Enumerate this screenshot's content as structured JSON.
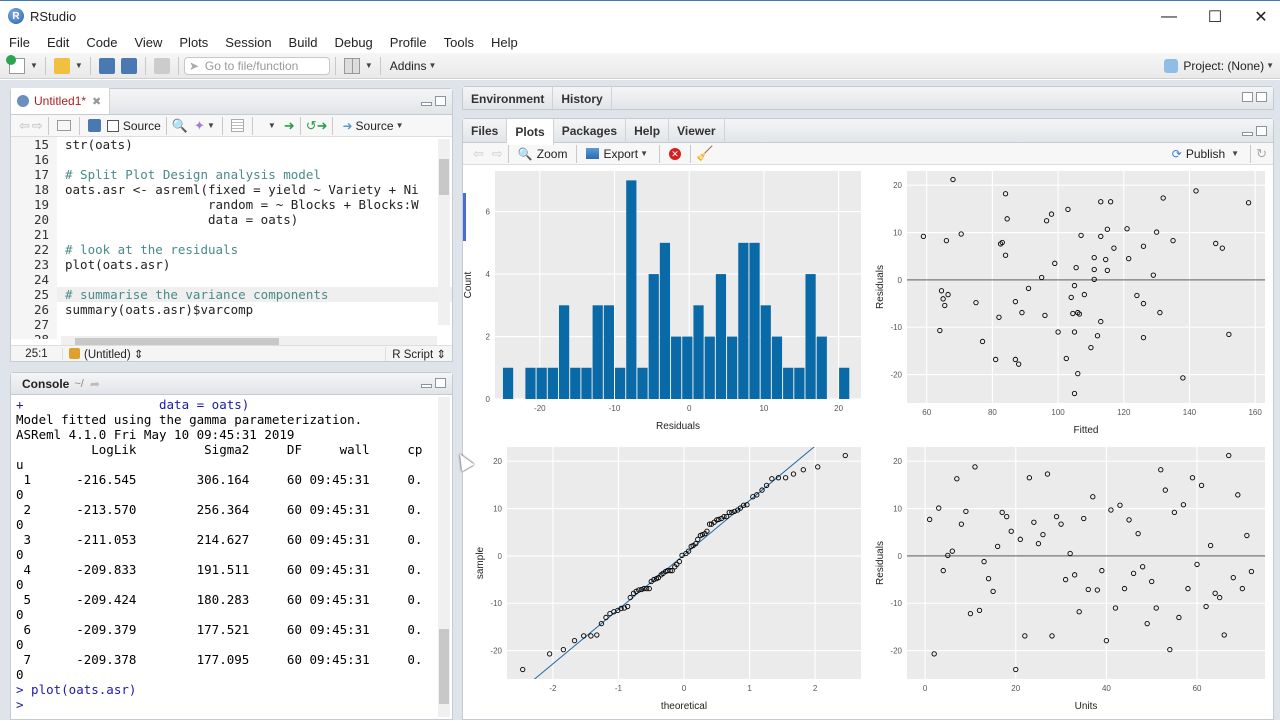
{
  "window": {
    "title": "RStudio",
    "controls": [
      "minimize",
      "maximize",
      "close"
    ]
  },
  "menu": [
    "File",
    "Edit",
    "Code",
    "View",
    "Plots",
    "Session",
    "Build",
    "Debug",
    "Profile",
    "Tools",
    "Help"
  ],
  "toolbar": {
    "goto_placeholder": "Go to file/function",
    "addins_label": "Addins",
    "project_label": "Project: (None)"
  },
  "editor": {
    "tab_label": "Untitled1*",
    "source_on_save_label": "Source",
    "source_label": "Source",
    "lines": [
      {
        "n": "15",
        "text": "str(oats)",
        "type": "code"
      },
      {
        "n": "16",
        "text": "",
        "type": "code"
      },
      {
        "n": "17",
        "text": "# Split Plot Design analysis model",
        "type": "comment"
      },
      {
        "n": "18",
        "text": "oats.asr <- asreml(fixed = yield ~ Variety + Ni",
        "type": "code"
      },
      {
        "n": "19",
        "text": "                   random = ~ Blocks + Blocks:W",
        "type": "code"
      },
      {
        "n": "20",
        "text": "                   data = oats)",
        "type": "code"
      },
      {
        "n": "21",
        "text": "",
        "type": "code"
      },
      {
        "n": "22",
        "text": "# look at the residuals",
        "type": "comment"
      },
      {
        "n": "23",
        "text": "plot(oats.asr)",
        "type": "code"
      },
      {
        "n": "24",
        "text": "",
        "type": "code"
      },
      {
        "n": "25",
        "text": "# summarise the variance components",
        "type": "comment",
        "current": true
      },
      {
        "n": "26",
        "text": "summary(oats.asr)$varcomp",
        "type": "code"
      },
      {
        "n": "27",
        "text": "",
        "type": "code"
      },
      {
        "n": "28",
        "text": "",
        "type": "code"
      }
    ],
    "status": {
      "position": "25:1",
      "scope": "(Untitled)",
      "file_type": "R Script"
    }
  },
  "console": {
    "title": "Console",
    "path": "~/",
    "lines": [
      {
        "text": "+                  data = oats)",
        "type": "cmd"
      },
      {
        "text": "Model fitted using the gamma parameterization.",
        "type": "out"
      },
      {
        "text": "ASReml 4.1.0 Fri May 10 09:45:31 2019",
        "type": "out"
      },
      {
        "text": "          LogLik         Sigma2     DF     wall     cp",
        "type": "out"
      },
      {
        "text": "u",
        "type": "out"
      },
      {
        "text": " 1      -216.545        306.164     60 09:45:31     0.",
        "type": "out"
      },
      {
        "text": "0",
        "type": "out"
      },
      {
        "text": " 2      -213.570        256.364     60 09:45:31     0.",
        "type": "out"
      },
      {
        "text": "0",
        "type": "out"
      },
      {
        "text": " 3      -211.053        214.627     60 09:45:31     0.",
        "type": "out"
      },
      {
        "text": "0",
        "type": "out"
      },
      {
        "text": " 4      -209.833        191.511     60 09:45:31     0.",
        "type": "out"
      },
      {
        "text": "0",
        "type": "out"
      },
      {
        "text": " 5      -209.424        180.283     60 09:45:31     0.",
        "type": "out"
      },
      {
        "text": "0",
        "type": "out"
      },
      {
        "text": " 6      -209.379        177.521     60 09:45:31     0.",
        "type": "out"
      },
      {
        "text": "0",
        "type": "out"
      },
      {
        "text": " 7      -209.378        177.095     60 09:45:31     0.",
        "type": "out"
      },
      {
        "text": "0",
        "type": "out"
      },
      {
        "text": "> plot(oats.asr)",
        "type": "cmd"
      },
      {
        "text": "> ",
        "type": "cmd"
      }
    ]
  },
  "env_pane": {
    "tabs": [
      "Environment",
      "History"
    ]
  },
  "plots_pane": {
    "tabs": [
      "Files",
      "Plots",
      "Packages",
      "Help",
      "Viewer"
    ],
    "active_tab": "Plots",
    "zoom_label": "Zoom",
    "export_label": "Export",
    "publish_label": "Publish"
  },
  "chart_data": [
    {
      "type": "bar",
      "title": "",
      "xlabel": "Residuals",
      "ylabel": "Count",
      "bin_start": -25,
      "bin_width": 1.5,
      "values": [
        1,
        0,
        1,
        1,
        1,
        3,
        1,
        1,
        3,
        3,
        1,
        7,
        1,
        4,
        5,
        2,
        2,
        3,
        2,
        4,
        2,
        5,
        5,
        3,
        2,
        1,
        1,
        4,
        2,
        0,
        1
      ],
      "xlim": [
        -26,
        23
      ],
      "ylim": [
        0,
        7.3
      ],
      "xticks": [
        -20,
        -10,
        0,
        10,
        20
      ],
      "yticks": [
        0,
        2,
        4,
        6
      ],
      "color": "#0a6aa8"
    },
    {
      "type": "scatter",
      "xlabel": "Fitted",
      "ylabel": "Residuals",
      "xlim": [
        54,
        163
      ],
      "ylim": [
        -26,
        23
      ],
      "xticks": [
        60,
        80,
        100,
        120,
        140,
        160
      ],
      "yticks": [
        -20,
        -10,
        0,
        10,
        20
      ],
      "hline": 0,
      "points": [
        [
          59,
          9.2
        ],
        [
          64,
          -10.7
        ],
        [
          64.5,
          -2.3
        ],
        [
          65,
          -4
        ],
        [
          65.5,
          -5.4
        ],
        [
          66,
          8.3
        ],
        [
          66.5,
          -3.1
        ],
        [
          68,
          21.2
        ],
        [
          70.5,
          9.7
        ],
        [
          75,
          -4.8
        ],
        [
          77,
          -13
        ],
        [
          81,
          -16.8
        ],
        [
          82,
          -7.9
        ],
        [
          82.5,
          7.6
        ],
        [
          83,
          7.9
        ],
        [
          84,
          18.2
        ],
        [
          84,
          5.2
        ],
        [
          84.5,
          12.9
        ],
        [
          87,
          -4.6
        ],
        [
          87,
          -16.8
        ],
        [
          88,
          -17.8
        ],
        [
          89,
          -6.9
        ],
        [
          91,
          -1.8
        ],
        [
          95,
          0.5
        ],
        [
          96,
          -7.5
        ],
        [
          96.5,
          12.5
        ],
        [
          98,
          13.9
        ],
        [
          99,
          3.5
        ],
        [
          100,
          -11
        ],
        [
          102.5,
          -16.6
        ],
        [
          103,
          14.9
        ],
        [
          104,
          -3.7
        ],
        [
          104.5,
          -7.1
        ],
        [
          105,
          -1.2
        ],
        [
          105,
          -11
        ],
        [
          105,
          -24
        ],
        [
          105.5,
          2.6
        ],
        [
          106,
          -19.8
        ],
        [
          106,
          -6.9
        ],
        [
          106.5,
          -7.2
        ],
        [
          107,
          9.4
        ],
        [
          108,
          -3.1
        ],
        [
          110,
          -14.3
        ],
        [
          111,
          2.2
        ],
        [
          111,
          0.1
        ],
        [
          111,
          4.7
        ],
        [
          112,
          -11.8
        ],
        [
          113,
          -8.8
        ],
        [
          113,
          9.2
        ],
        [
          113,
          16.5
        ],
        [
          114.5,
          4.3
        ],
        [
          115,
          2
        ],
        [
          115,
          10.7
        ],
        [
          116,
          16.5
        ],
        [
          117,
          6.7
        ],
        [
          121,
          10.8
        ],
        [
          121.5,
          4.5
        ],
        [
          124,
          -3.3
        ],
        [
          126,
          7.1
        ],
        [
          126,
          -5
        ],
        [
          126,
          -12.2
        ],
        [
          129,
          1
        ],
        [
          130,
          10.1
        ],
        [
          131,
          -6.9
        ],
        [
          132,
          17.3
        ],
        [
          135,
          8.3
        ],
        [
          138,
          -20.7
        ],
        [
          142,
          18.8
        ],
        [
          148,
          7.7
        ],
        [
          150,
          6.7
        ],
        [
          152,
          -11.5
        ],
        [
          158,
          16.3
        ]
      ]
    },
    {
      "type": "scatter",
      "xlabel": "theoretical",
      "ylabel": "sample",
      "xlim": [
        -2.7,
        2.7
      ],
      "ylim": [
        -26,
        23
      ],
      "xticks": [
        -2,
        -1,
        0,
        1,
        2
      ],
      "yticks": [
        -20,
        -10,
        0,
        10,
        20
      ],
      "line": {
        "intercept": 0.2,
        "slope": 11.5,
        "color": "#1f6aa5"
      },
      "points": [
        [
          -2.46,
          -24
        ],
        [
          -2.05,
          -20.7
        ],
        [
          -1.84,
          -19.8
        ],
        [
          -1.67,
          -17.9
        ],
        [
          -1.53,
          -16.9
        ],
        [
          -1.42,
          -16.9
        ],
        [
          -1.33,
          -16.7
        ],
        [
          -1.26,
          -14.3
        ],
        [
          -1.19,
          -13
        ],
        [
          -1.13,
          -12.2
        ],
        [
          -1.07,
          -11.8
        ],
        [
          -1.01,
          -11.5
        ],
        [
          -0.96,
          -11.1
        ],
        [
          -0.91,
          -11
        ],
        [
          -0.86,
          -10.7
        ],
        [
          -0.82,
          -8.8
        ],
        [
          -0.77,
          -7.9
        ],
        [
          -0.73,
          -7.5
        ],
        [
          -0.69,
          -7.2
        ],
        [
          -0.65,
          -7.1
        ],
        [
          -0.61,
          -6.9
        ],
        [
          -0.57,
          -6.9
        ],
        [
          -0.53,
          -6.9
        ],
        [
          -0.5,
          -5.4
        ],
        [
          -0.46,
          -5
        ],
        [
          -0.42,
          -4.8
        ],
        [
          -0.39,
          -4.6
        ],
        [
          -0.35,
          -4
        ],
        [
          -0.32,
          -3.7
        ],
        [
          -0.28,
          -3.3
        ],
        [
          -0.25,
          -3.1
        ],
        [
          -0.21,
          -3.1
        ],
        [
          -0.18,
          -3.1
        ],
        [
          -0.14,
          -2.3
        ],
        [
          -0.11,
          -1.8
        ],
        [
          -0.07,
          -1.2
        ],
        [
          -0.03,
          0.1
        ],
        [
          0.03,
          0.5
        ],
        [
          0.07,
          1
        ],
        [
          0.11,
          2
        ],
        [
          0.14,
          2.2
        ],
        [
          0.18,
          2.6
        ],
        [
          0.21,
          3.5
        ],
        [
          0.25,
          4.3
        ],
        [
          0.28,
          4.5
        ],
        [
          0.32,
          4.7
        ],
        [
          0.35,
          5.2
        ],
        [
          0.39,
          6.7
        ],
        [
          0.42,
          6.7
        ],
        [
          0.46,
          7.1
        ],
        [
          0.5,
          7.6
        ],
        [
          0.53,
          7.7
        ],
        [
          0.57,
          7.9
        ],
        [
          0.61,
          8.3
        ],
        [
          0.65,
          8.3
        ],
        [
          0.69,
          9.2
        ],
        [
          0.73,
          9.2
        ],
        [
          0.77,
          9.4
        ],
        [
          0.82,
          9.7
        ],
        [
          0.86,
          10.1
        ],
        [
          0.91,
          10.7
        ],
        [
          0.96,
          10.8
        ],
        [
          1.05,
          12.5
        ],
        [
          1.11,
          12.9
        ],
        [
          1.19,
          13.9
        ],
        [
          1.26,
          14.9
        ],
        [
          1.34,
          16.3
        ],
        [
          1.44,
          16.5
        ],
        [
          1.55,
          16.5
        ],
        [
          1.67,
          17.3
        ],
        [
          1.82,
          18.2
        ],
        [
          2.04,
          18.8
        ],
        [
          2.46,
          21.2
        ]
      ]
    },
    {
      "type": "scatter",
      "xlabel": "Units",
      "ylabel": "Residuals",
      "xlim": [
        -4,
        75
      ],
      "ylim": [
        -26,
        23
      ],
      "xticks": [
        0,
        20,
        40,
        60
      ],
      "yticks": [
        -20,
        -10,
        0,
        10,
        20
      ],
      "hline": 0,
      "points": [
        [
          1,
          7.7
        ],
        [
          2,
          -20.7
        ],
        [
          3,
          10.1
        ],
        [
          4,
          -3.1
        ],
        [
          5,
          0.1
        ],
        [
          6,
          1
        ],
        [
          7,
          16.3
        ],
        [
          8,
          6.7
        ],
        [
          9,
          9.4
        ],
        [
          10,
          -12.2
        ],
        [
          11,
          18.8
        ],
        [
          12,
          -11.5
        ],
        [
          13,
          -1.2
        ],
        [
          14,
          -4.8
        ],
        [
          15,
          -7.5
        ],
        [
          16,
          2
        ],
        [
          17,
          9.2
        ],
        [
          18,
          8.3
        ],
        [
          19,
          5.2
        ],
        [
          20,
          -24
        ],
        [
          21,
          3.5
        ],
        [
          22,
          -16.9
        ],
        [
          23,
          16.5
        ],
        [
          24,
          7.1
        ],
        [
          25,
          2.6
        ],
        [
          26,
          4.5
        ],
        [
          27,
          17.3
        ],
        [
          28,
          -16.9
        ],
        [
          29,
          8.3
        ],
        [
          30,
          6.7
        ],
        [
          31,
          -5
        ],
        [
          32,
          0.5
        ],
        [
          33,
          -4
        ],
        [
          34,
          -11.8
        ],
        [
          35,
          7.9
        ],
        [
          36,
          -7.1
        ],
        [
          37,
          12.5
        ],
        [
          38,
          -7.2
        ],
        [
          39,
          -3.1
        ],
        [
          40,
          -17.9
        ],
        [
          41,
          9.7
        ],
        [
          42,
          -11
        ],
        [
          43,
          10.7
        ],
        [
          44,
          -6.9
        ],
        [
          45,
          7.6
        ],
        [
          46,
          -3.7
        ],
        [
          47,
          4.7
        ],
        [
          48,
          -2.3
        ],
        [
          49,
          -14.3
        ],
        [
          50,
          -5.4
        ],
        [
          51,
          -11
        ],
        [
          52,
          18.2
        ],
        [
          53,
          13.9
        ],
        [
          54,
          -19.8
        ],
        [
          55,
          9.2
        ],
        [
          56,
          -13
        ],
        [
          57,
          10.8
        ],
        [
          58,
          -6.9
        ],
        [
          59,
          16.5
        ],
        [
          60,
          -1.8
        ],
        [
          61,
          14.9
        ],
        [
          62,
          -10.7
        ],
        [
          63,
          2.2
        ],
        [
          64,
          -7.9
        ],
        [
          65,
          -8.8
        ],
        [
          66,
          -16.7
        ],
        [
          67,
          21.2
        ],
        [
          68,
          -4.6
        ],
        [
          69,
          12.9
        ],
        [
          70,
          -6.9
        ],
        [
          71,
          4.3
        ],
        [
          72,
          -3.3
        ]
      ]
    }
  ]
}
